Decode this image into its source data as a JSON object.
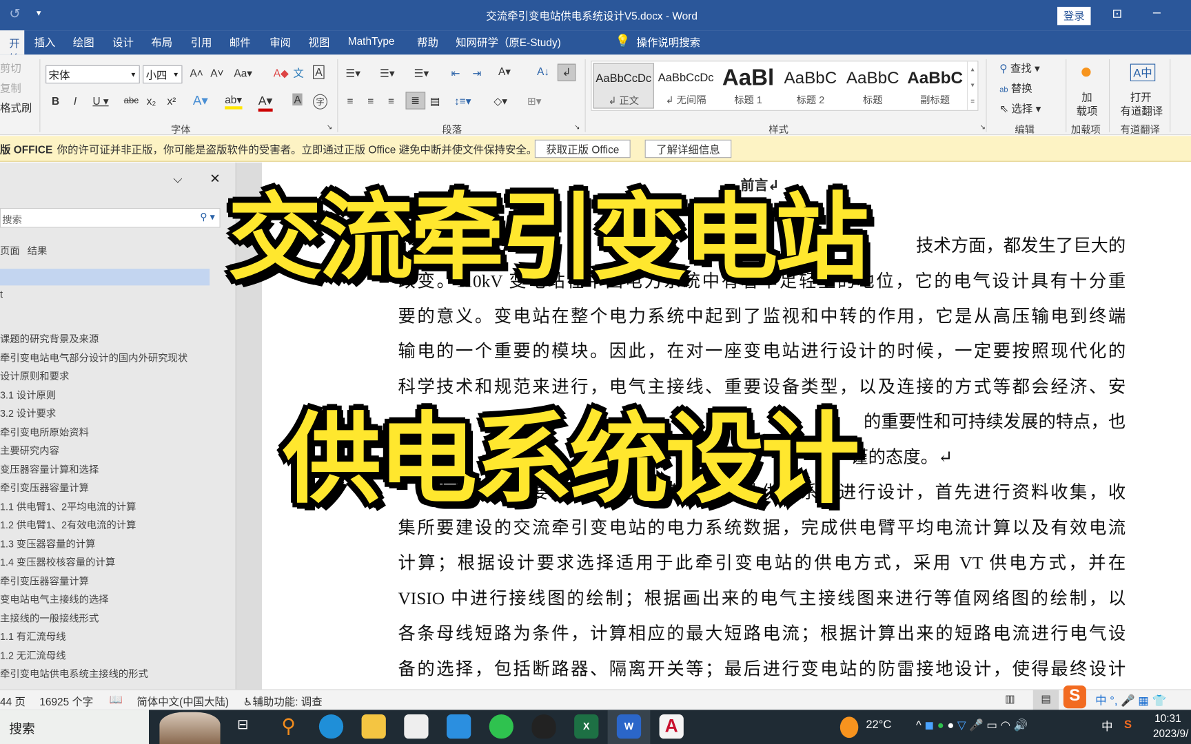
{
  "titlebar": {
    "title": "交流牵引变电站供电系统设计V5.docx  -  Word",
    "login": "登录"
  },
  "tabs": [
    "开始",
    "插入",
    "绘图",
    "设计",
    "布局",
    "引用",
    "邮件",
    "审阅",
    "视图",
    "MathType",
    "帮助",
    "知网研学（原E-Study)"
  ],
  "tell_me": "操作说明搜索",
  "clipboard": {
    "cut": "剪切",
    "copy": "复制",
    "format_painter": "格式刷"
  },
  "font": {
    "name": "宋体",
    "size": "小四",
    "group": "字体"
  },
  "paragraph": {
    "group": "段落"
  },
  "styles": {
    "group": "样式",
    "items": [
      {
        "sample": "AaBbCcDc",
        "name": "↲ 正文"
      },
      {
        "sample": "AaBbCcDc",
        "name": "↲ 无间隔"
      },
      {
        "sample": "AaBl",
        "name": "标题 1"
      },
      {
        "sample": "AaBbC",
        "name": "标题 2"
      },
      {
        "sample": "AaBbC",
        "name": "标题"
      },
      {
        "sample": "AaBbC",
        "name": "副标题"
      }
    ]
  },
  "editing": {
    "find": "查找",
    "replace": "替换",
    "select": "选择",
    "group": "编辑"
  },
  "addins": {
    "label1": "加",
    "label2": "载项",
    "group": "加载项"
  },
  "youdao": {
    "label1": "打开",
    "label2": "有道翻译",
    "group": "有道翻译"
  },
  "warning": {
    "bold": "版 OFFICE",
    "text": "你的许可证并非正版，你可能是盗版软件的受害者。立即通过正版 Office 避免中断并使文件保持安全。",
    "btn1": "获取正版 Office",
    "btn2": "了解详细信息"
  },
  "nav": {
    "search_placeholder": "搜索",
    "tab_pages": "页面",
    "tab_results": "结果",
    "items": [
      "",
      "t",
      "课题的研究背景及来源",
      "牵引变电站电气部分设计的国内外研究现状",
      "设计原则和要求",
      "3.1 设计原则",
      "3.2 设计要求",
      "牵引变电所原始资料",
      "主要研究内容",
      "变压器容量计算和选择",
      "牵引变压器容量计算",
      "1.1 供电臂1、2平均电流的计算",
      "1.2 供电臂1、2有效电流的计算",
      "1.3 变压器容量的计算",
      "1.4 变压器校核容量的计算",
      "牵引变压器容量计算",
      "变电站电气主接线的选择",
      "主接线的一般接线形式",
      "1.1 有汇流母线",
      "1.2 无汇流母线",
      "牵引变电站供电系统主接线的形式"
    ]
  },
  "document": {
    "heading_fragment": "前言↲",
    "lines": [
      "技术方面，都发生了巨大的",
      "改变。110kV 变电站在中国电力系统中有着举足轻重的地位，它的电气设计具有十分重",
      "要的意义。变电站在整个电力系统中起到了监视和中转的作用，它是从高压输电到终端",
      "输电的一个重要的模块。因此，在对一座变电站进行设计的时候，一定要按照现代化的",
      "科学技术和规范来进行，电气主接线、重要设备类型，以及连接的方式等都会经济、安",
      "的重要性和可持续发展的特点，也",
      "谨的态度。↵",
      "本设计的主要内容为对交流牵引变电站供电系统进行设计，首先进行资料收集，收",
      "集所要建设的交流牵引变电站的电力系统数据，完成供电臂平均电流计算以及有效电流",
      "计算；根据设计要求选择适用于此牵引变电站的供电方式，采用 VT 供电方式，并在",
      "VISIO 中进行接线图的绘制；根据画出来的电气主接线图来进行等值网络图的绘制，以",
      "各条母线短路为条件，计算相应的最大短路电流；根据计算出来的短路电流进行电气设",
      "备的选择，包括断路器、隔离开关等；最后进行变电站的防雷接地设计，使得最终设计"
    ]
  },
  "overlay": {
    "line1": "交流牵引变电站",
    "line2": "供电系统设计",
    "color": "#ffe72e"
  },
  "status": {
    "pages": "44 页",
    "words": "16925 个字",
    "language": "简体中文(中国大陆)",
    "accessibility": "辅助功能: 调查"
  },
  "taskbar": {
    "search": "搜索",
    "weather": "22°C",
    "ime": "中",
    "time": "10:31",
    "date": "2023/9/"
  },
  "colors": {
    "word_blue": "#2b579a",
    "warning_bar": "#fdf3c4",
    "taskbar": "#1f2b34"
  }
}
